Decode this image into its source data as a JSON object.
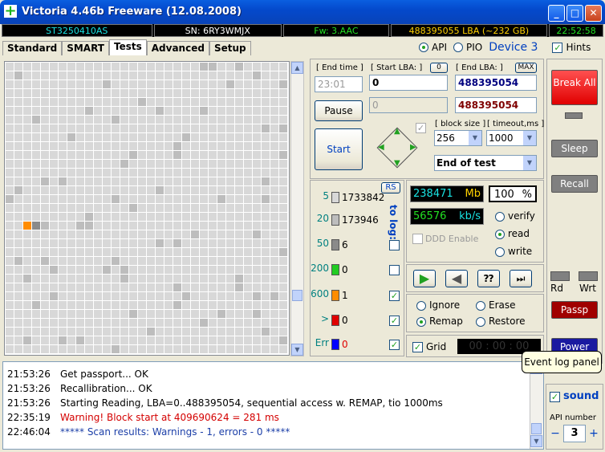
{
  "window": {
    "title": "Victoria 4.46b Freeware (12.08.2008)",
    "app_icon": "+",
    "min": "_",
    "max": "□",
    "close": "✕"
  },
  "info": {
    "model": "ST3250410AS",
    "serial": "SN: 6RY3WMJX",
    "firmware": "Fw: 3.AAC",
    "lba": "488395055 LBA (~232 GB)",
    "clock": "22:52:58"
  },
  "tabs": [
    {
      "label": "Standard"
    },
    {
      "label": "SMART"
    },
    {
      "label": "Tests"
    },
    {
      "label": "Advanced"
    },
    {
      "label": "Setup"
    }
  ],
  "access": {
    "api": "API",
    "pio": "PIO",
    "device": "Device 3",
    "hints": "Hints"
  },
  "test": {
    "end_time_label": "[ End time ]",
    "end_time": "23:01",
    "start_lba_label": "[ Start LBA: ]",
    "start_lba_zero": "0",
    "start_lba": "0",
    "start_lba2": "0",
    "end_lba_label": "[ End LBA: ]",
    "end_lba_max": "MAX",
    "end_lba": "488395054",
    "end_lba2": "488395054",
    "pause": "Pause",
    "start": "Start",
    "block_size_label": "[ block size ]",
    "block_size": "256",
    "timeout_label": "[ timeout,ms ]",
    "timeout": "1000",
    "end_mode": "End of test"
  },
  "legend": {
    "rs": "RS",
    "to_log": "to log:",
    "rows": [
      {
        "ms": "5",
        "count": "1733842",
        "color": "#d8d8d8",
        "log": false
      },
      {
        "ms": "20",
        "count": "173946",
        "color": "#bdbdbd",
        "log": false
      },
      {
        "ms": "50",
        "count": "6",
        "color": "#8a8a8a",
        "log": false
      },
      {
        "ms": "200",
        "count": "0",
        "color": "#22cc22",
        "log": false
      },
      {
        "ms": "600",
        "count": "1",
        "color": "#ff8c00",
        "log": true
      },
      {
        "ms": ">",
        "count": "0",
        "color": "#e00000",
        "log": true
      },
      {
        "ms": "Err",
        "count": "0",
        "color": "#0000ff",
        "log": true
      }
    ]
  },
  "stats": {
    "mb": "238471",
    "mb_unit": "Mb",
    "percent": "100",
    "pct_unit": "%",
    "speed": "56576",
    "speed_unit": "kb/s",
    "ddd": "DDD Enable",
    "verify": "verify",
    "read": "read",
    "write": "write"
  },
  "actions": {
    "ignore": "Ignore",
    "erase": "Erase",
    "remap": "Remap",
    "restore": "Restore",
    "grid": "Grid",
    "timer": "00 : 00 : 00"
  },
  "right": {
    "break": "Break All",
    "sleep": "Sleep",
    "recall": "Recall",
    "rd": "Rd",
    "wrt": "Wrt",
    "passp": "Passp",
    "power": "Power",
    "sound": "sound",
    "api_number_label": "API number",
    "api_number": "3",
    "minus": "−",
    "plus": "+"
  },
  "tooltip": "Event log panel",
  "log": [
    {
      "time": "21:53:26",
      "msg": "Get passport... OK",
      "color": "#000000"
    },
    {
      "time": "21:53:26",
      "msg": "Recallibration... OK",
      "color": "#000000"
    },
    {
      "time": "21:53:26",
      "msg": "Starting Reading, LBA=0..488395054, sequential access w. REMAP, tio 1000ms",
      "color": "#000000"
    },
    {
      "time": "22:35:19",
      "msg": "Warning! Block start at 409690624 = 281 ms",
      "color": "#d40000"
    },
    {
      "time": "22:46:04",
      "msg": "***** Scan results: Warnings - 1, errors - 0 *****",
      "color": "#1c3fa8"
    }
  ]
}
